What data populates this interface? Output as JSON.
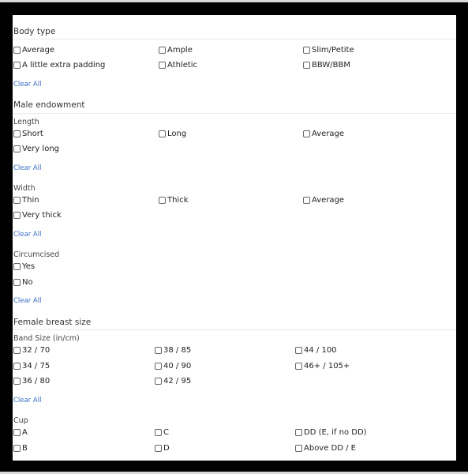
{
  "body_type": {
    "title": "Body type",
    "options": [
      "Average",
      "Ample",
      "Slim/Petite",
      "A little extra padding",
      "Athletic",
      "BBW/BBM"
    ],
    "clear_label": "Clear All"
  },
  "male_endowment": {
    "title": "Male endowment",
    "length": {
      "title": "Length",
      "options": [
        "Short",
        "Long",
        "Average",
        "Very long"
      ],
      "clear_label": "Clear All"
    },
    "width": {
      "title": "Width",
      "options": [
        "Thin",
        "Thick",
        "Average",
        "Very thick"
      ],
      "clear_label": "Clear All"
    },
    "circumcised": {
      "title": "Circumcised",
      "options": [
        "Yes",
        "No"
      ],
      "clear_label": "Clear All"
    }
  },
  "female_breast_size": {
    "title": "Female breast size",
    "band": {
      "title": "Band Size (in/cm)",
      "options": [
        "32 / 70",
        "38 / 85",
        "44 / 100",
        "34 / 75",
        "40 / 90",
        "46+ / 105+",
        "36 / 80",
        "42 / 95"
      ],
      "clear_label": "Clear All"
    },
    "cup": {
      "title": "Cup",
      "options": [
        "A",
        "C",
        "DD (E, if no DD)",
        "B",
        "D",
        "Above DD / E"
      ]
    }
  }
}
